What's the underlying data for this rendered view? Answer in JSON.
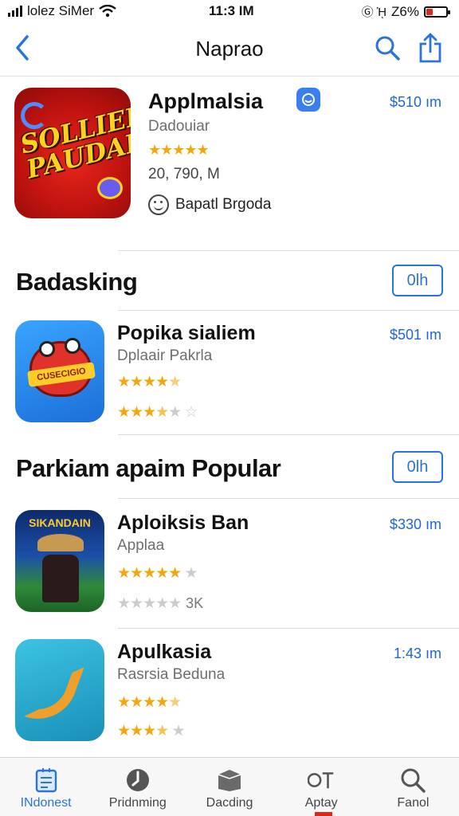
{
  "status_bar": {
    "carrier": "lolez SiMer",
    "time": "11:3 IM",
    "icons_right": "Ⓖ ᾘ ",
    "battery_pct": "Z6%"
  },
  "nav": {
    "title": "Naprao"
  },
  "featured": {
    "name": "Applmalsia",
    "developer": "Dadouiar",
    "price": "$510 ım",
    "stars": "★★★★★",
    "count": "20, 790, M",
    "badge_label": "Bapatl Brgoda",
    "icon_text": "SOLLIEK PAUDAI"
  },
  "section1": {
    "title": "Badasking",
    "button": "0lh",
    "app": {
      "name": "Popika sialiem",
      "developer": "Dplaair Pakrla",
      "price": "$501 ım",
      "icon_text": "CUSECIGIO",
      "stars": "★★★★",
      "stars_half": "★",
      "stars2": "★★★",
      "stars2_half": "★",
      "stars2_rest": "★ ☆",
      "rating": 4.5
    }
  },
  "section2": {
    "title": "Parkiam apaim Popular",
    "button": "0lh",
    "apps": [
      {
        "name": "Aploiksis Ban",
        "developer": "Applaa",
        "price": "$330 ım",
        "icon_text": "SIKANDAIN",
        "stars": "★★★★★",
        "stars_dim": "★",
        "stars2_dim": "★★★★★",
        "extra": "3K"
      },
      {
        "name": "Apulkasia",
        "developer": "Rasrsia Beduna",
        "price": "1:43 ım",
        "stars": "★★★★",
        "stars_half": "★",
        "stars2": "★★★",
        "stars2_half": "★",
        "stars2_dim": "★"
      }
    ]
  },
  "tabs": [
    {
      "label": "INdonest",
      "icon": "today-icon",
      "active": true
    },
    {
      "label": "Pridnming",
      "icon": "games-icon",
      "active": false
    },
    {
      "label": "Dacding",
      "icon": "apps-icon",
      "active": false
    },
    {
      "label": "Aptay",
      "icon": "arcade-icon",
      "active": false
    },
    {
      "label": "Fanol",
      "icon": "search-icon",
      "active": false
    }
  ],
  "colors": {
    "accent": "#2a74d8",
    "price": "#1f66d0",
    "star": "#f3a60e",
    "battery_low": "#e0271e"
  }
}
